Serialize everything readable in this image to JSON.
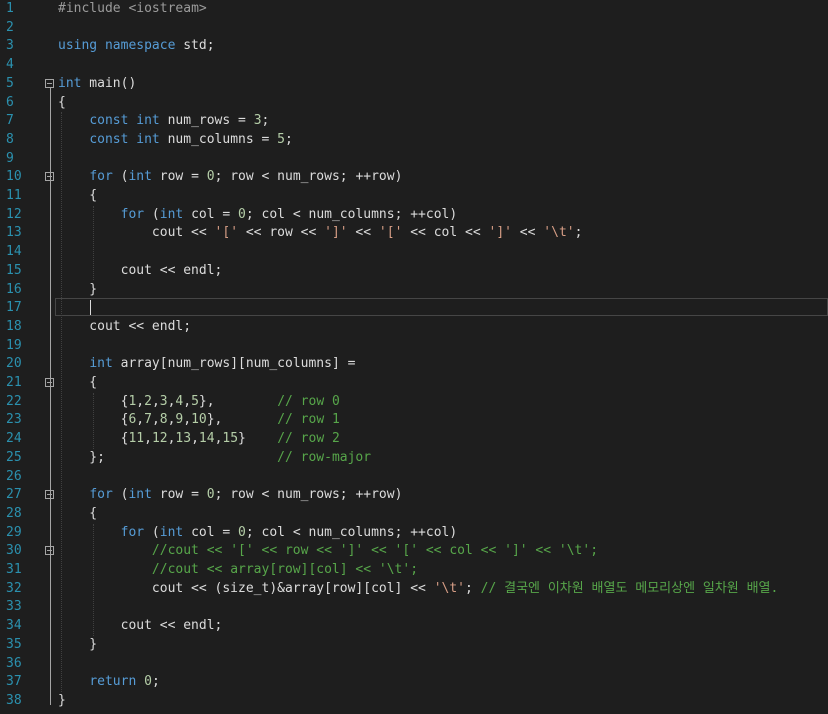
{
  "editor": {
    "lines": [
      {
        "n": "1",
        "tokens": [
          {
            "t": "#include ",
            "c": "pp"
          },
          {
            "t": "<iostream>",
            "c": "pp"
          }
        ]
      },
      {
        "n": "2",
        "tokens": []
      },
      {
        "n": "3",
        "tokens": [
          {
            "t": "using namespace",
            "c": "kw"
          },
          {
            "t": " std;",
            "c": "ident"
          }
        ]
      },
      {
        "n": "4",
        "tokens": []
      },
      {
        "n": "5",
        "tokens": [
          {
            "t": "int",
            "c": "kw"
          },
          {
            "t": " main()",
            "c": "ident"
          }
        ]
      },
      {
        "n": "6",
        "tokens": [
          {
            "t": "{",
            "c": "ident"
          }
        ]
      },
      {
        "n": "7",
        "tokens": [
          {
            "t": "    ",
            "c": "ident"
          },
          {
            "t": "const int",
            "c": "kw"
          },
          {
            "t": " num_rows = ",
            "c": "ident"
          },
          {
            "t": "3",
            "c": "num"
          },
          {
            "t": ";",
            "c": "ident"
          }
        ]
      },
      {
        "n": "8",
        "tokens": [
          {
            "t": "    ",
            "c": "ident"
          },
          {
            "t": "const int",
            "c": "kw"
          },
          {
            "t": " num_columns = ",
            "c": "ident"
          },
          {
            "t": "5",
            "c": "num"
          },
          {
            "t": ";",
            "c": "ident"
          }
        ]
      },
      {
        "n": "9",
        "tokens": []
      },
      {
        "n": "10",
        "tokens": [
          {
            "t": "    ",
            "c": "ident"
          },
          {
            "t": "for",
            "c": "kw"
          },
          {
            "t": " (",
            "c": "ident"
          },
          {
            "t": "int",
            "c": "kw"
          },
          {
            "t": " row = ",
            "c": "ident"
          },
          {
            "t": "0",
            "c": "num"
          },
          {
            "t": "; row < num_rows; ++row)",
            "c": "ident"
          }
        ]
      },
      {
        "n": "11",
        "tokens": [
          {
            "t": "    {",
            "c": "ident"
          }
        ]
      },
      {
        "n": "12",
        "tokens": [
          {
            "t": "        ",
            "c": "ident"
          },
          {
            "t": "for",
            "c": "kw"
          },
          {
            "t": " (",
            "c": "ident"
          },
          {
            "t": "int",
            "c": "kw"
          },
          {
            "t": " col = ",
            "c": "ident"
          },
          {
            "t": "0",
            "c": "num"
          },
          {
            "t": "; col < num_columns; ++col)",
            "c": "ident"
          }
        ]
      },
      {
        "n": "13",
        "tokens": [
          {
            "t": "            cout << ",
            "c": "ident"
          },
          {
            "t": "'['",
            "c": "str"
          },
          {
            "t": " << row << ",
            "c": "ident"
          },
          {
            "t": "']'",
            "c": "str"
          },
          {
            "t": " << ",
            "c": "ident"
          },
          {
            "t": "'['",
            "c": "str"
          },
          {
            "t": " << col << ",
            "c": "ident"
          },
          {
            "t": "']'",
            "c": "str"
          },
          {
            "t": " << ",
            "c": "ident"
          },
          {
            "t": "'\\t'",
            "c": "str"
          },
          {
            "t": ";",
            "c": "ident"
          }
        ]
      },
      {
        "n": "14",
        "tokens": []
      },
      {
        "n": "15",
        "tokens": [
          {
            "t": "        cout << endl;",
            "c": "ident"
          }
        ]
      },
      {
        "n": "16",
        "tokens": [
          {
            "t": "    }",
            "c": "ident"
          }
        ]
      },
      {
        "n": "17",
        "tokens": []
      },
      {
        "n": "18",
        "tokens": [
          {
            "t": "    cout << endl;",
            "c": "ident"
          }
        ]
      },
      {
        "n": "19",
        "tokens": []
      },
      {
        "n": "20",
        "tokens": [
          {
            "t": "    ",
            "c": "ident"
          },
          {
            "t": "int",
            "c": "kw"
          },
          {
            "t": " array[num_rows][num_columns] =",
            "c": "ident"
          }
        ]
      },
      {
        "n": "21",
        "tokens": [
          {
            "t": "    {",
            "c": "ident"
          }
        ]
      },
      {
        "n": "22",
        "tokens": [
          {
            "t": "        {",
            "c": "ident"
          },
          {
            "t": "1",
            "c": "num"
          },
          {
            "t": ",",
            "c": "ident"
          },
          {
            "t": "2",
            "c": "num"
          },
          {
            "t": ",",
            "c": "ident"
          },
          {
            "t": "3",
            "c": "num"
          },
          {
            "t": ",",
            "c": "ident"
          },
          {
            "t": "4",
            "c": "num"
          },
          {
            "t": ",",
            "c": "ident"
          },
          {
            "t": "5",
            "c": "num"
          },
          {
            "t": "},        ",
            "c": "ident"
          },
          {
            "t": "// row 0",
            "c": "cm"
          }
        ]
      },
      {
        "n": "23",
        "tokens": [
          {
            "t": "        {",
            "c": "ident"
          },
          {
            "t": "6",
            "c": "num"
          },
          {
            "t": ",",
            "c": "ident"
          },
          {
            "t": "7",
            "c": "num"
          },
          {
            "t": ",",
            "c": "ident"
          },
          {
            "t": "8",
            "c": "num"
          },
          {
            "t": ",",
            "c": "ident"
          },
          {
            "t": "9",
            "c": "num"
          },
          {
            "t": ",",
            "c": "ident"
          },
          {
            "t": "10",
            "c": "num"
          },
          {
            "t": "},       ",
            "c": "ident"
          },
          {
            "t": "// row 1",
            "c": "cm"
          }
        ]
      },
      {
        "n": "24",
        "tokens": [
          {
            "t": "        {",
            "c": "ident"
          },
          {
            "t": "11",
            "c": "num"
          },
          {
            "t": ",",
            "c": "ident"
          },
          {
            "t": "12",
            "c": "num"
          },
          {
            "t": ",",
            "c": "ident"
          },
          {
            "t": "13",
            "c": "num"
          },
          {
            "t": ",",
            "c": "ident"
          },
          {
            "t": "14",
            "c": "num"
          },
          {
            "t": ",",
            "c": "ident"
          },
          {
            "t": "15",
            "c": "num"
          },
          {
            "t": "}    ",
            "c": "ident"
          },
          {
            "t": "// row 2",
            "c": "cm"
          }
        ]
      },
      {
        "n": "25",
        "tokens": [
          {
            "t": "    };                      ",
            "c": "ident"
          },
          {
            "t": "// row-major",
            "c": "cm"
          }
        ]
      },
      {
        "n": "26",
        "tokens": []
      },
      {
        "n": "27",
        "tokens": [
          {
            "t": "    ",
            "c": "ident"
          },
          {
            "t": "for",
            "c": "kw"
          },
          {
            "t": " (",
            "c": "ident"
          },
          {
            "t": "int",
            "c": "kw"
          },
          {
            "t": " row = ",
            "c": "ident"
          },
          {
            "t": "0",
            "c": "num"
          },
          {
            "t": "; row < num_rows; ++row)",
            "c": "ident"
          }
        ]
      },
      {
        "n": "28",
        "tokens": [
          {
            "t": "    {",
            "c": "ident"
          }
        ]
      },
      {
        "n": "29",
        "tokens": [
          {
            "t": "        ",
            "c": "ident"
          },
          {
            "t": "for",
            "c": "kw"
          },
          {
            "t": " (",
            "c": "ident"
          },
          {
            "t": "int",
            "c": "kw"
          },
          {
            "t": " col = ",
            "c": "ident"
          },
          {
            "t": "0",
            "c": "num"
          },
          {
            "t": "; col < num_columns; ++col)",
            "c": "ident"
          }
        ]
      },
      {
        "n": "30",
        "tokens": [
          {
            "t": "            ",
            "c": "ident"
          },
          {
            "t": "//cout << '[' << row << ']' << '[' << col << ']' << '\\t';",
            "c": "cm"
          }
        ]
      },
      {
        "n": "31",
        "tokens": [
          {
            "t": "            ",
            "c": "ident"
          },
          {
            "t": "//cout << array[row][col] << '\\t';",
            "c": "cm"
          }
        ]
      },
      {
        "n": "32",
        "tokens": [
          {
            "t": "            cout << (size_t)&array[row][col] << ",
            "c": "ident"
          },
          {
            "t": "'\\t'",
            "c": "str"
          },
          {
            "t": "; ",
            "c": "ident"
          },
          {
            "t": "// 결국엔 이차원 배열도 메모리상엔 일차원 배열.",
            "c": "cm"
          }
        ]
      },
      {
        "n": "33",
        "tokens": []
      },
      {
        "n": "34",
        "tokens": [
          {
            "t": "        cout << endl;",
            "c": "ident"
          }
        ]
      },
      {
        "n": "35",
        "tokens": [
          {
            "t": "    }",
            "c": "ident"
          }
        ]
      },
      {
        "n": "36",
        "tokens": []
      },
      {
        "n": "37",
        "tokens": [
          {
            "t": "    ",
            "c": "ident"
          },
          {
            "t": "return",
            "c": "kw"
          },
          {
            "t": " ",
            "c": "ident"
          },
          {
            "t": "0",
            "c": "num"
          },
          {
            "t": ";",
            "c": "ident"
          }
        ]
      },
      {
        "n": "38",
        "tokens": [
          {
            "t": "}",
            "c": "ident"
          }
        ]
      }
    ],
    "fold_markers_at_lines": [
      "5",
      "10",
      "21",
      "27",
      "30"
    ]
  }
}
